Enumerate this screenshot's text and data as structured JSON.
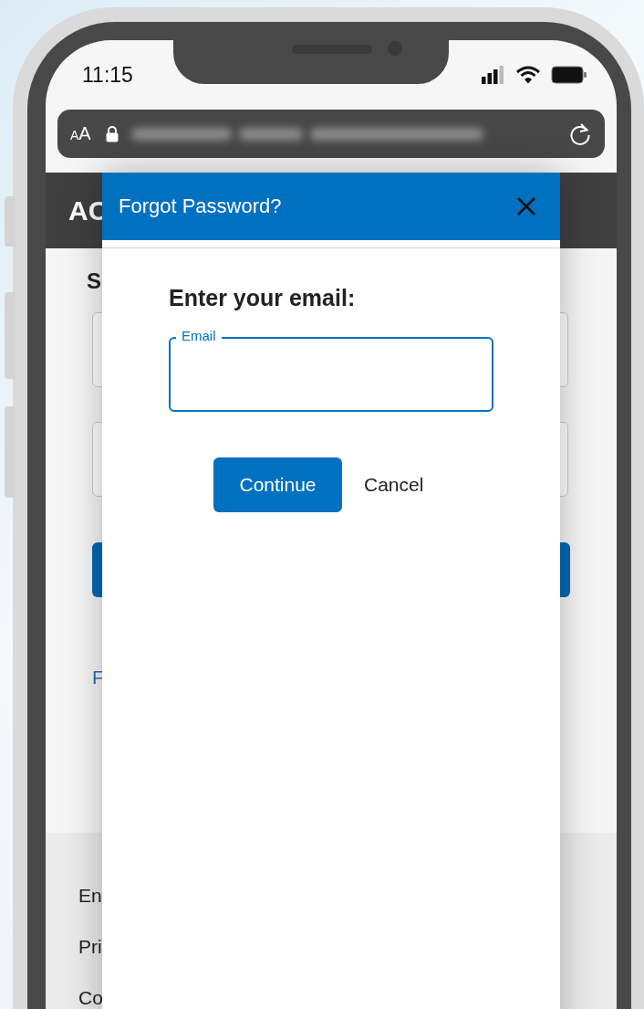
{
  "status_bar": {
    "time": "11:15"
  },
  "browser": {
    "text_size_button": "AA"
  },
  "page": {
    "logo": "AC",
    "heading": "S",
    "link": "F",
    "footer_links": [
      "En",
      "Pri",
      "Co"
    ]
  },
  "dialog": {
    "title": "Forgot Password?",
    "prompt": "Enter your email:",
    "email_field": {
      "label": "Email"
    },
    "buttons": [
      {
        "label": "Continue",
        "kind": "primary"
      },
      {
        "label": "Cancel",
        "kind": "plain"
      }
    ]
  }
}
